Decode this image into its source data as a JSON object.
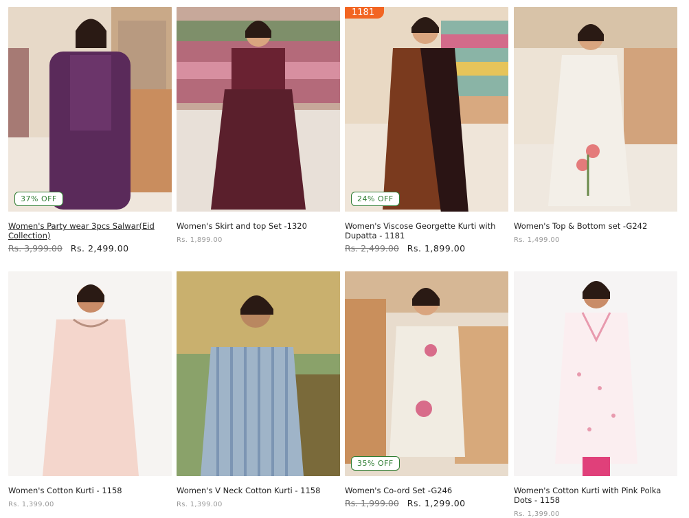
{
  "products": [
    {
      "title": "Women's Party wear 3pcs Salwar(Eid Collection)",
      "old_price": "Rs. 3,999.00",
      "price": "Rs. 2,499.00",
      "discount": "37% OFF",
      "tag": ""
    },
    {
      "title": "Women's Skirt and top Set -1320",
      "old_price": "Rs. 1,899.00",
      "price": "",
      "discount": "",
      "tag": ""
    },
    {
      "title": "Women's Viscose Georgette Kurti with Dupatta - 1181",
      "old_price": "Rs. 2,499.00",
      "price": "Rs. 1,899.00",
      "discount": "24% OFF",
      "tag": "1181"
    },
    {
      "title": "Women's Top & Bottom set -G242",
      "old_price": "Rs. 1,499.00",
      "price": "",
      "discount": "",
      "tag": ""
    },
    {
      "title": "Women's Cotton Kurti - 1158",
      "old_price": "Rs. 1,399.00",
      "price": "",
      "discount": "",
      "tag": ""
    },
    {
      "title": "Women's V Neck Cotton Kurti - 1158",
      "old_price": "Rs. 1,399.00",
      "price": "",
      "discount": "",
      "tag": ""
    },
    {
      "title": "Women's Co-ord Set -G246",
      "old_price": "Rs. 1,999.00",
      "price": "Rs. 1,299.00",
      "discount": "35% OFF",
      "tag": ""
    },
    {
      "title": "Women's Cotton Kurti with Pink Polka Dots - 1158",
      "old_price": "Rs. 1,399.00",
      "price": "",
      "discount": "",
      "tag": ""
    }
  ],
  "colors": {
    "discount_green": "#2e7d32",
    "tag_orange": "#f26522"
  }
}
